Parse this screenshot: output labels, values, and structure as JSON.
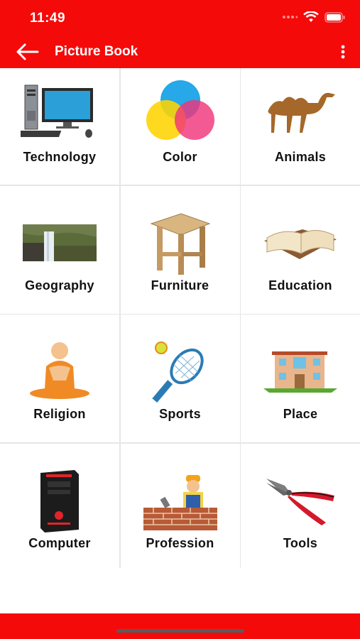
{
  "status_bar": {
    "time": "11:49"
  },
  "app_bar": {
    "title": "Picture Book"
  },
  "colors": {
    "accent": "#f50a0a",
    "background": "#ffffff",
    "label": "#111111"
  },
  "categories": [
    {
      "label": "Technology",
      "icon": "desktop-computer-icon"
    },
    {
      "label": "Color",
      "icon": "color-circles-icon"
    },
    {
      "label": "Animals",
      "icon": "camel-icon"
    },
    {
      "label": "Geography",
      "icon": "waterfall-icon"
    },
    {
      "label": "Furniture",
      "icon": "stool-icon"
    },
    {
      "label": "Education",
      "icon": "open-book-icon"
    },
    {
      "label": "Religion",
      "icon": "monk-icon"
    },
    {
      "label": "Sports",
      "icon": "tennis-racket-icon"
    },
    {
      "label": "Place",
      "icon": "building-icon"
    },
    {
      "label": "Computer",
      "icon": "cpu-tower-icon"
    },
    {
      "label": "Profession",
      "icon": "bricklayer-icon"
    },
    {
      "label": "Tools",
      "icon": "pliers-icon"
    }
  ]
}
